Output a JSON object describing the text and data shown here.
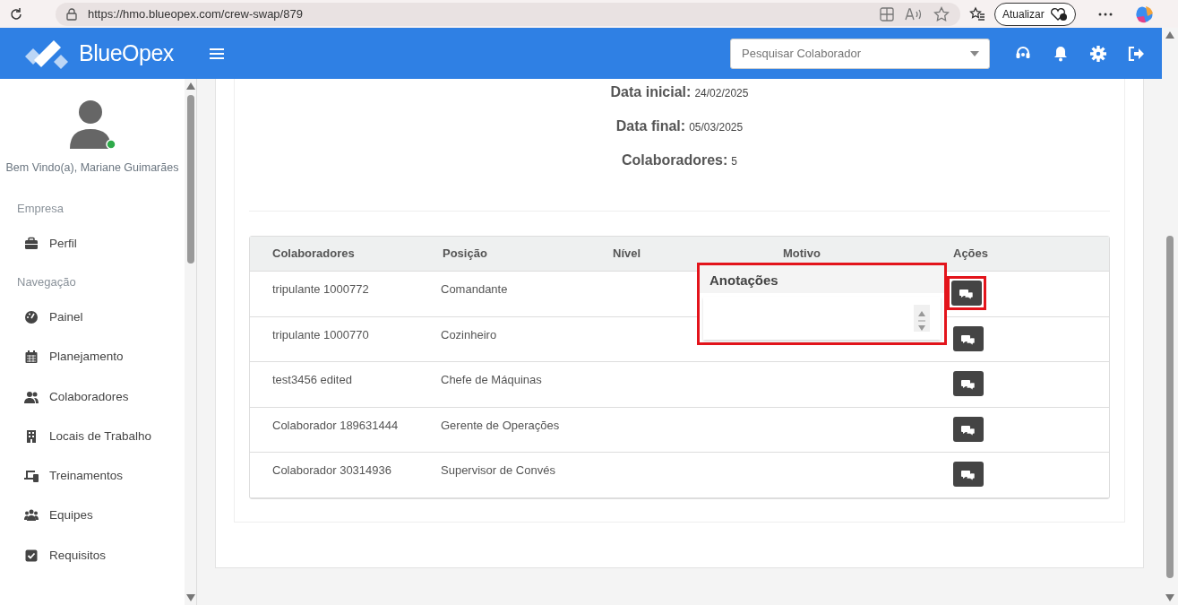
{
  "browser": {
    "url": "https://hmo.blueopex.com/crew-swap/879",
    "update_button": "Atualizar"
  },
  "navbar": {
    "brand": "BlueOpex",
    "search": {
      "placeholder": "Pesquisar Colaborador"
    }
  },
  "sidebar": {
    "welcome": "Bem Vindo(a), Mariane Guimarães",
    "online": true,
    "sections": [
      {
        "title": "Empresa",
        "items": [
          {
            "label": "Perfil"
          }
        ]
      },
      {
        "title": "Navegação",
        "items": [
          {
            "label": "Painel"
          },
          {
            "label": "Planejamento"
          },
          {
            "label": "Colaboradores"
          },
          {
            "label": "Locais de Trabalho"
          },
          {
            "label": "Treinamentos"
          },
          {
            "label": "Equipes"
          },
          {
            "label": "Requisitos"
          }
        ]
      }
    ]
  },
  "summary": [
    {
      "label": "Data inicial:",
      "value": "24/02/2025"
    },
    {
      "label": "Data final:",
      "value": "05/03/2025"
    },
    {
      "label": "Colaboradores:",
      "value": "5"
    }
  ],
  "table": {
    "columns": [
      "Colaboradores",
      "Posição",
      "Nível",
      "Motivo",
      "Ações"
    ],
    "rows": [
      {
        "cells": [
          "tripulante 1000772",
          "Comandante"
        ],
        "highlighted": true
      },
      {
        "cells": [
          "tripulante 1000770",
          "Cozinheiro"
        ],
        "highlighted": false
      },
      {
        "cells": [
          "test3456 edited",
          "Chefe de Máquinas"
        ],
        "highlighted": false
      },
      {
        "cells": [
          "Colaborador 189631444",
          "Gerente de Operações"
        ],
        "highlighted": false
      },
      {
        "cells": [
          "Colaborador 30314936",
          "Supervisor de Convés"
        ],
        "highlighted": false
      }
    ]
  },
  "popover": {
    "title": "Anotações"
  }
}
